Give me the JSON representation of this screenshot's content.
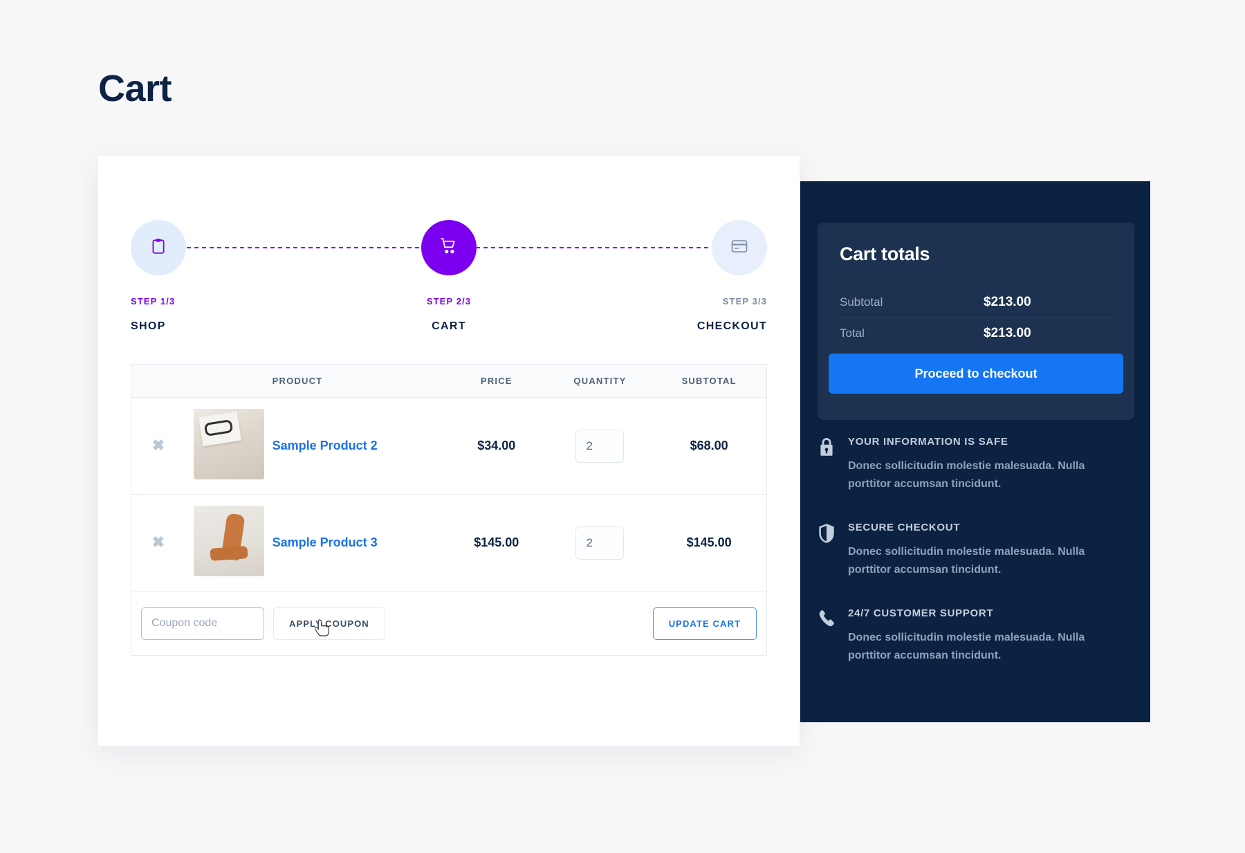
{
  "page": {
    "title": "Cart",
    "background_color": "#f7f7f8",
    "title_color": "#0d2244"
  },
  "steps": {
    "accent_color": "#7c00f0",
    "items": [
      {
        "num": "STEP 1/3",
        "name": "SHOP",
        "icon": "clipboard-icon",
        "state": "done"
      },
      {
        "num": "STEP 2/3",
        "name": "CART",
        "icon": "shopping-cart-icon",
        "state": "active"
      },
      {
        "num": "STEP 3/3",
        "name": "CHECKOUT",
        "icon": "credit-card-icon",
        "state": "upcoming"
      }
    ]
  },
  "cart_table": {
    "headers": {
      "remove": "",
      "thumb": "",
      "product": "PRODUCT",
      "price": "PRICE",
      "quantity": "QUANTITY",
      "subtotal": "SUBTOTAL"
    },
    "rows": [
      {
        "remove_icon": "remove-item-icon",
        "thumb_alt": "glasses-on-book-thumbnail",
        "name": "Sample Product 2",
        "price": "$34.00",
        "quantity": "2",
        "subtotal": "$68.00"
      },
      {
        "remove_icon": "remove-item-icon",
        "thumb_alt": "leather-chair-thumbnail",
        "name": "Sample Product 3",
        "price": "$145.00",
        "quantity": "2",
        "subtotal": "$145.00"
      }
    ],
    "coupon": {
      "placeholder": "Coupon code",
      "value": "",
      "apply_label": "APPLY COUPON",
      "update_label": "UPDATE CART"
    }
  },
  "totals": {
    "title": "Cart totals",
    "rows": [
      {
        "label": "Subtotal",
        "value": "$213.00"
      },
      {
        "label": "Total",
        "value": "$213.00"
      }
    ],
    "checkout_label": "Proceed to checkout",
    "button_color": "#1476f2",
    "panel_color": "#0b2242",
    "card_color": "#1d3250"
  },
  "badges": [
    {
      "icon": "lock-icon",
      "title": "YOUR INFORMATION IS SAFE",
      "text": "Donec sollicitudin molestie malesuada. Nulla porttitor accumsan tincidunt."
    },
    {
      "icon": "shield-icon",
      "title": "SECURE CHECKOUT",
      "text": "Donec sollicitudin molestie malesuada. Nulla porttitor accumsan tincidunt."
    },
    {
      "icon": "phone-icon",
      "title": "24/7 CUSTOMER SUPPORT",
      "text": "Donec sollicitudin molestie malesuada. Nulla porttitor accumsan tincidunt."
    }
  ]
}
